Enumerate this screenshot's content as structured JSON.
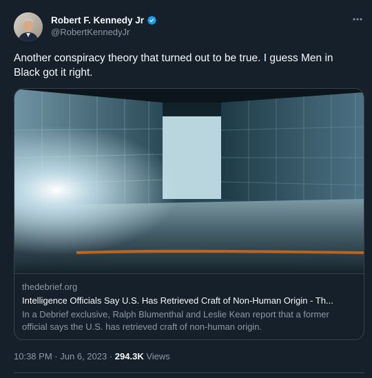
{
  "author": {
    "display_name": "Robert F. Kennedy Jr",
    "handle": "@RobertKennedyJr",
    "verified": true
  },
  "tweet": {
    "text": "Another conspiracy theory that turned out to be true. I guess Men in Black got it right."
  },
  "card": {
    "domain": "thedebrief.org",
    "title": "Intelligence Officials Say U.S. Has Retrieved Craft of Non-Human Origin - Th...",
    "description": "In a Debrief exclusive, Ralph Blumenthal and Leslie Kean report that a former official says the U.S. has retrieved craft of non-human origin."
  },
  "meta": {
    "time": "10:38 PM",
    "separator": "·",
    "date": "Jun 6, 2023",
    "views_count": "294.3K",
    "views_label": "Views"
  },
  "icons": {
    "more": "more-horizontal-icon",
    "verified": "verified-badge-icon"
  },
  "colors": {
    "background": "#15202b",
    "primary_text": "#f7f9f9",
    "secondary_text": "#8b98a5",
    "border": "#38444d",
    "verified_blue": "#1d9bf0"
  }
}
